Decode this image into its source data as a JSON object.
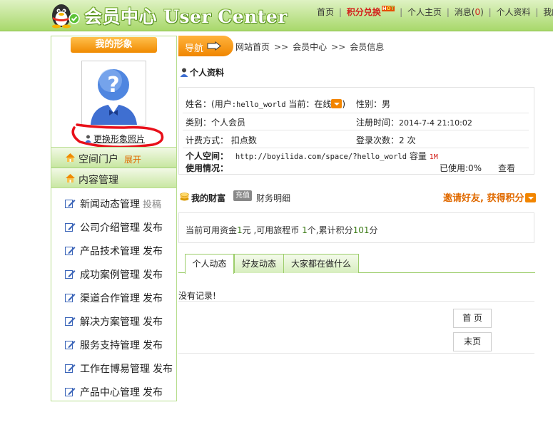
{
  "header": {
    "title": "会员中心 User Center",
    "top_nav": {
      "home": "首页",
      "points_exchange": "积分兑换",
      "hot_badge": "HOT",
      "personal_home": "个人主页",
      "messages": "消息",
      "message_count": "0",
      "profile": "个人资料",
      "mine": "我的",
      "brand_red": "#d3211c"
    }
  },
  "sidebar": {
    "avatar_title": "我的形象",
    "change_photo": "更换形象照片",
    "sections": [
      {
        "label": "空间门户",
        "action": "展开"
      },
      {
        "label": "内容管理",
        "action": ""
      }
    ],
    "items": [
      {
        "label": "新闻动态管理",
        "action": "投稿"
      },
      {
        "label": "公司介绍管理",
        "action": "发布"
      },
      {
        "label": "产品技术管理",
        "action": "发布"
      },
      {
        "label": "成功案例管理",
        "action": "发布"
      },
      {
        "label": "渠道合作管理",
        "action": "发布"
      },
      {
        "label": "解决方案管理",
        "action": "发布"
      },
      {
        "label": "服务支持管理",
        "action": "发布"
      },
      {
        "label": "工作在博易管理",
        "action": "发布"
      },
      {
        "label": "产品中心管理",
        "action": "发布"
      }
    ]
  },
  "nav": {
    "label": "导航",
    "breadcrumb": [
      "网站首页",
      "会员中心",
      "会员信息"
    ],
    "separator": ">>"
  },
  "profile": {
    "title": "个人资料",
    "name_label": "姓名：",
    "name_value_prefix": "(用户",
    "username": ":hello_world",
    "status_label": "当前：",
    "status_value": "在线",
    "status_close": ")",
    "gender_label": "性别：",
    "gender_value": "男",
    "type_label": "类别：",
    "type_value": "个人会员",
    "reg_label": "注册时间：",
    "reg_value": "2014-7-4 21:10:02",
    "billing_label": "计费方式：",
    "billing_value": "扣点数",
    "login_label": "登录次数：",
    "login_value": "2 次",
    "space_label": "个人空间：",
    "space_url": "http://boyilida.com/space/?hello_world",
    "capacity_label": "容量",
    "capacity_value": "1M",
    "usage_label": "使用情况：",
    "used_label": "已使用:",
    "used_value": "0%",
    "view_link": "查看"
  },
  "wealth": {
    "title": "我的财富",
    "recharge": "充值",
    "detail": "财务明细",
    "invite": "邀请好友, 获得积分",
    "balance_prefix": "当前可用资金",
    "balance_amount": "1",
    "balance_unit": "元 ,可用旅程币 ",
    "coins": "1",
    "coins_unit": "个,累计积分",
    "points": "101",
    "points_unit": "分"
  },
  "tabs": [
    {
      "label": "个人动态",
      "active": true
    },
    {
      "label": "好友动态",
      "active": false
    },
    {
      "label": "大家都在做什么",
      "active": false
    }
  ],
  "activity": {
    "empty": "没有记录!",
    "first_page": "首 页",
    "last_page": "末页"
  },
  "colors": {
    "header_green": "#a8d86b",
    "accent_orange": "#f08a00",
    "invite_orange": "#e06a00",
    "tab_border": "#9ccd6a"
  }
}
